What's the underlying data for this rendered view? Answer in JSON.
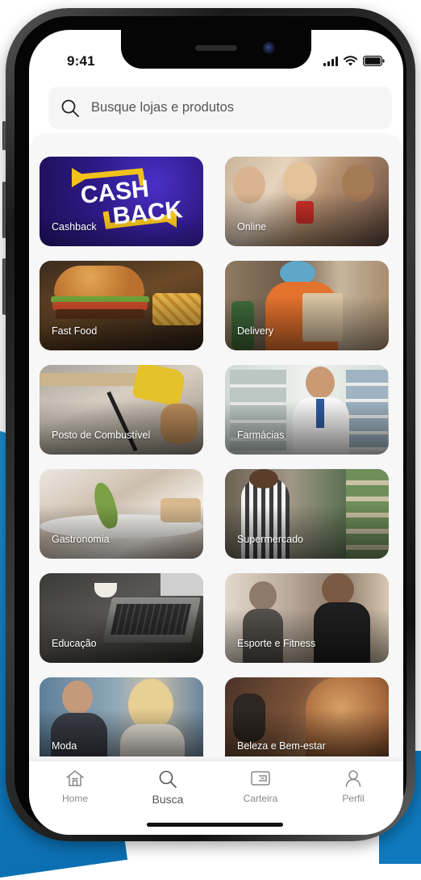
{
  "status_bar": {
    "time": "9:41"
  },
  "search": {
    "placeholder": "Busque lojas e produtos"
  },
  "categories": [
    {
      "label": "Cashback",
      "logo_line1": "CASH",
      "logo_line2": "BACK"
    },
    {
      "label": "Online"
    },
    {
      "label": "Fast Food"
    },
    {
      "label": "Delivery"
    },
    {
      "label": "Posto de Combustível"
    },
    {
      "label": "Farmácias"
    },
    {
      "label": "Gastronomia"
    },
    {
      "label": "Supermercado"
    },
    {
      "label": "Educação"
    },
    {
      "label": "Esporte e Fitness"
    },
    {
      "label": "Moda"
    },
    {
      "label": "Beleza e Bem-estar"
    }
  ],
  "tab_bar": {
    "items": [
      {
        "label": "Home",
        "icon": "home-icon"
      },
      {
        "label": "Busca",
        "icon": "search-icon",
        "active": true
      },
      {
        "label": "Carteira",
        "icon": "wallet-icon"
      },
      {
        "label": "Perfil",
        "icon": "user-icon"
      }
    ]
  },
  "colors": {
    "accent_blue": "#0b6fb3",
    "cashback_purple": "#3b1d8f",
    "cashback_yellow": "#f2c21b"
  }
}
